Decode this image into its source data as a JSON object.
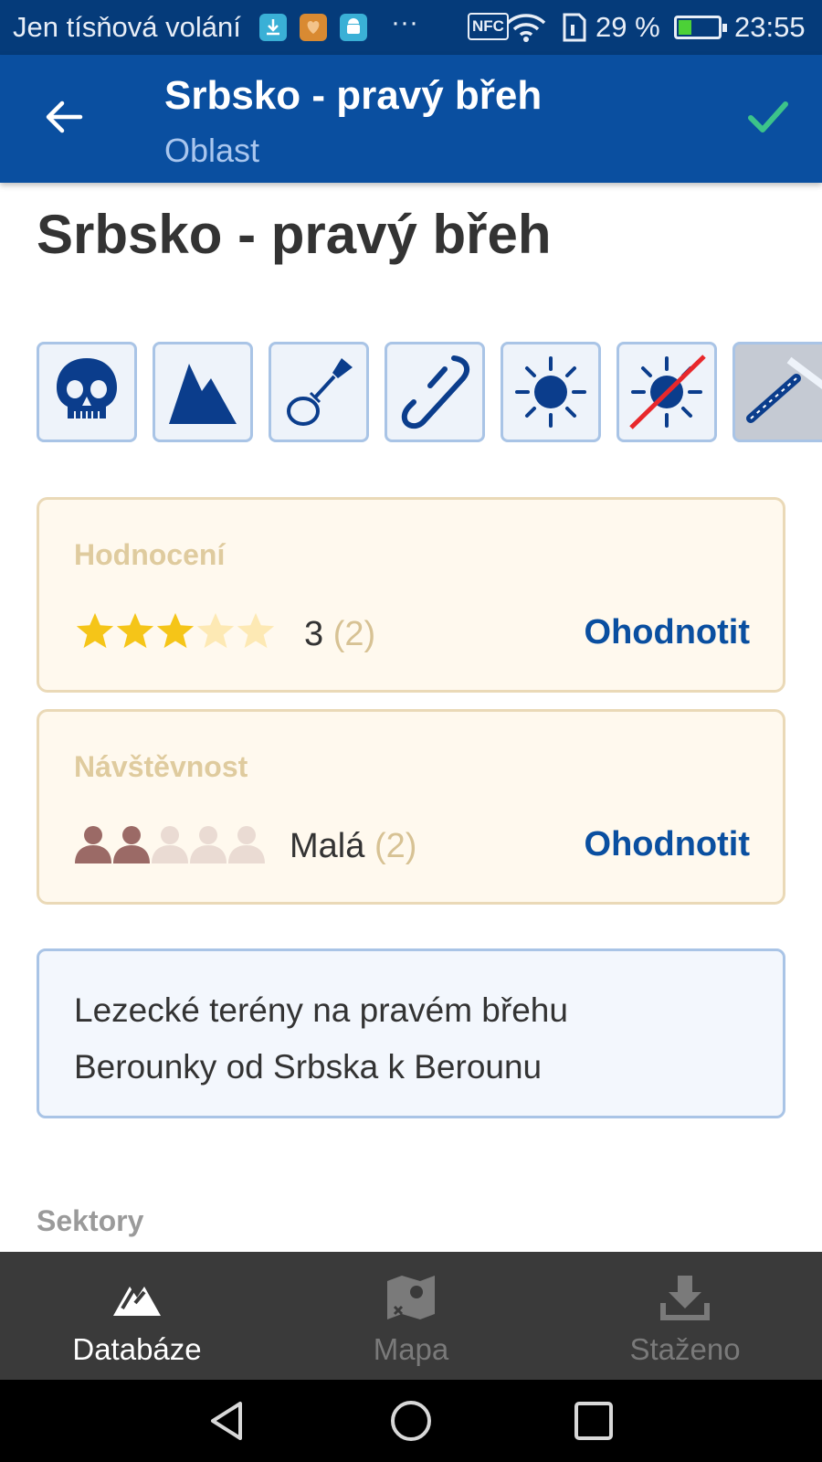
{
  "status_bar": {
    "carrier_text": "Jen tísňová volání",
    "more": "···",
    "nfc": "NFC",
    "battery_percent": "29 %",
    "time": "23:55",
    "battery_level": 0.29
  },
  "app_bar": {
    "title": "Srbsko - pravý břeh",
    "subtitle": "Oblast",
    "back_icon": "arrow-left-icon",
    "confirm_icon": "check-icon",
    "confirm_color": "#3cc38a"
  },
  "page": {
    "title": "Srbsko - pravý břeh"
  },
  "feature_icons": [
    "skull-icon",
    "mountain-icon",
    "rope-sling-icon",
    "quickdraw-icon",
    "sun-icon",
    "no-sun-icon",
    "bolt-hanger-icon"
  ],
  "rating": {
    "label": "Hodnocení",
    "value": "3",
    "count": "(2)",
    "stars_filled": 3,
    "stars_total": 5,
    "action": "Ohodnotit",
    "star_color": "#f5c518",
    "star_empty_color": "#fde9b4"
  },
  "visitors": {
    "label": "Návštěvnost",
    "value": "Malá",
    "count": "(2)",
    "people_filled": 2,
    "people_total": 5,
    "action": "Ohodnotit",
    "person_color": "#9b6a66",
    "person_empty_color": "#eadbd3"
  },
  "description": {
    "line1": "Lezecké terény na pravém břehu",
    "line2": "Berounky od Srbska k Berounu"
  },
  "sections": {
    "sectors_label": "Sektory"
  },
  "bottom_nav": {
    "items": [
      {
        "label": "Databáze",
        "icon": "mountain-outline-icon",
        "active": true
      },
      {
        "label": "Mapa",
        "icon": "map-icon",
        "active": false
      },
      {
        "label": "Staženo",
        "icon": "download-icon",
        "active": false
      }
    ]
  },
  "colors": {
    "primary": "#0a4fa0",
    "status_bar": "#053b7a",
    "accent_link": "#0a4fa0"
  }
}
